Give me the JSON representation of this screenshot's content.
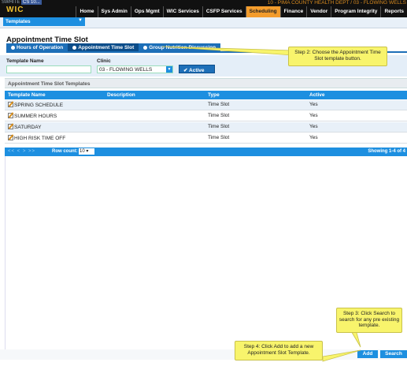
{
  "header": {
    "user": "SWHITE",
    "user_badge": "CS 10...",
    "logo": "WIC",
    "agency": "10 - PIMA COUNTY HEALTH DEPT / 03 - FLOWING WELLS",
    "menu": [
      "Home",
      "Sys Admin",
      "Ops Mgmt",
      "WIC Services",
      "CSFP Services",
      "Scheduling",
      "Finance",
      "Vendor",
      "Program Integrity",
      "Reports"
    ],
    "active_menu": "Scheduling"
  },
  "subbar": {
    "dropdown_label": "Templates"
  },
  "page": {
    "title": "Appointment Time Slot",
    "tabs": [
      "Hours of Operation",
      "Appointment Time Slot",
      "Group Nutrition Discussion"
    ],
    "active_tab": "Appointment Time Slot"
  },
  "filter": {
    "template_name_label": "Template Name",
    "template_name_value": "",
    "clinic_label": "Clinic",
    "clinic_value": "03 - FLOWING WELLS",
    "active_button": "✔ Active"
  },
  "table": {
    "section_title": "Appointment Time Slot Templates",
    "columns": [
      "Template Name",
      "Description",
      "Type",
      "Active"
    ],
    "rows": [
      {
        "name": "SPRING SCHEDULE",
        "description": "",
        "type": "Time Slot",
        "active": "Yes"
      },
      {
        "name": "SUMMER HOURS",
        "description": "",
        "type": "Time Slot",
        "active": "Yes"
      },
      {
        "name": "SATURDAY",
        "description": "",
        "type": "Time Slot",
        "active": "Yes"
      },
      {
        "name": "HIGH RISK TIME OFF",
        "description": "",
        "type": "Time Slot",
        "active": "Yes"
      }
    ],
    "pager": {
      "nav": "<< < > >>",
      "row_count_label": "Row count:",
      "row_count_value": "10",
      "showing": "Showing 1-4 of 4"
    }
  },
  "buttons": {
    "add": "Add",
    "search": "Search"
  },
  "callouts": {
    "step2": "Step 2: Choose the Appointment Time Slot template button.",
    "step3": "Step 3: Click Search to search for any pre existing template.",
    "step4": "Step 4: Click Add to add a new Appointment Slot Template."
  },
  "colors": {
    "accent": "#1d8fe0",
    "tab_bar": "#1d6fb8",
    "active_menu": "#f39c2c",
    "callout": "#f8f46c"
  }
}
